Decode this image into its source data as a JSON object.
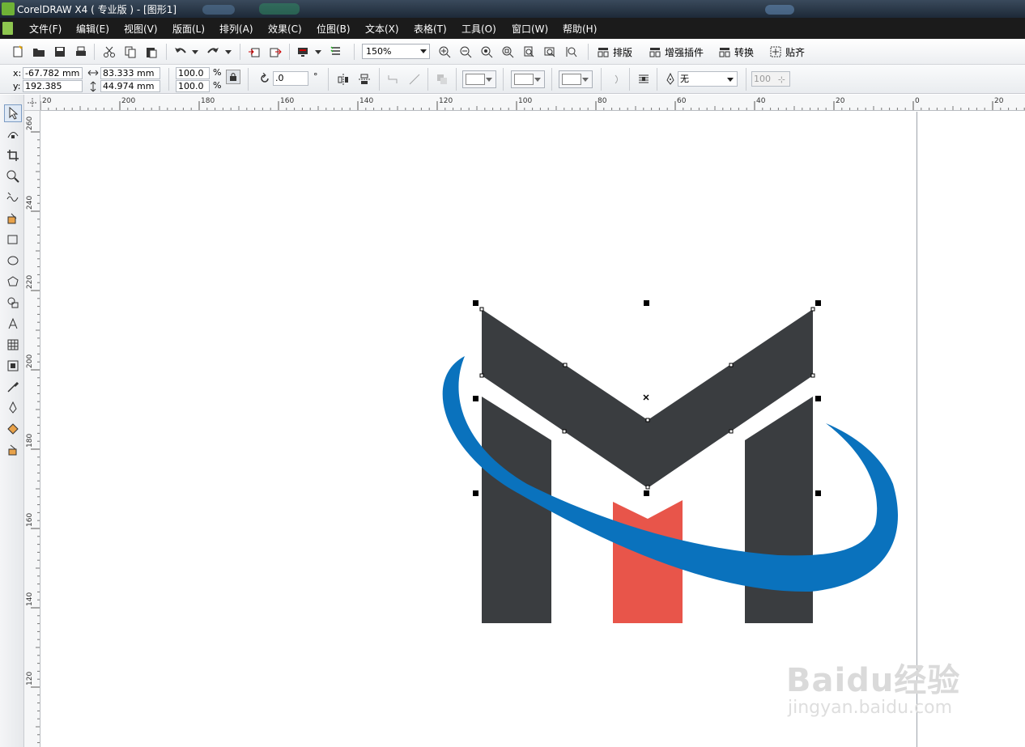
{
  "window": {
    "title": "CorelDRAW X4 ( 专业版 ) - [图形1]"
  },
  "menu": {
    "items": [
      {
        "label": "文件(F)"
      },
      {
        "label": "编辑(E)"
      },
      {
        "label": "视图(V)"
      },
      {
        "label": "版面(L)"
      },
      {
        "label": "排列(A)"
      },
      {
        "label": "效果(C)"
      },
      {
        "label": "位图(B)"
      },
      {
        "label": "文本(X)"
      },
      {
        "label": "表格(T)"
      },
      {
        "label": "工具(O)"
      },
      {
        "label": "窗口(W)"
      },
      {
        "label": "帮助(H)"
      }
    ]
  },
  "toolbar": {
    "zoom_value": "150%",
    "layout_label": "排版",
    "plugins_label": "增强插件",
    "convert_label": "转换",
    "snap_label": "贴齐"
  },
  "property_bar": {
    "x_label": "x:",
    "y_label": "y:",
    "x_value": "-67.782 mm",
    "y_value": "192.385 mm",
    "width_value": "83.333 mm",
    "height_value": "44.974 mm",
    "scale_x": "100.0",
    "scale_y": "100.0",
    "percent": "%",
    "rotation_value": ".0",
    "degree": "°",
    "outline_value": "无",
    "transparency_value": "100"
  },
  "rulers": {
    "horizontal": [
      "20",
      "200",
      "180",
      "160",
      "140",
      "120",
      "100",
      "80",
      "60",
      "40",
      "20",
      "0",
      "20"
    ],
    "vertical": [
      "260",
      "240",
      "220",
      "200",
      "180",
      "160",
      "140",
      "120"
    ]
  },
  "colors": {
    "logo_dark": "#3a3d40",
    "logo_red": "#e8554a",
    "logo_blue": "#0a72bd"
  },
  "watermark": {
    "main": "Baidu经验",
    "sub": "jingyan.baidu.com"
  }
}
